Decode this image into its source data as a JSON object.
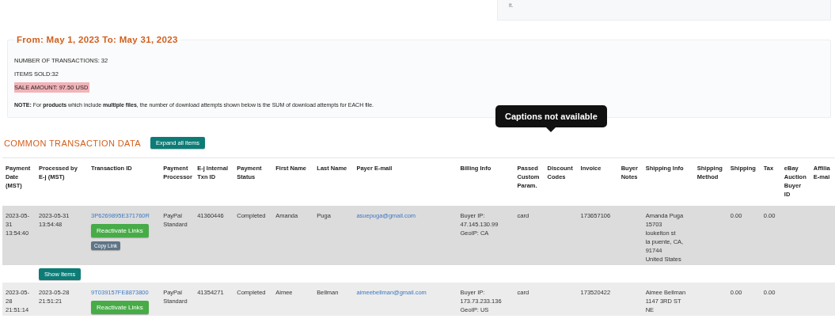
{
  "top_note": {
    "text": "it."
  },
  "summary": {
    "title": "From: May 1, 2023 To: May 31, 2023",
    "lines": [
      {
        "text": "NUMBER OF TRANSACTIONS: 32",
        "highlighted": false
      },
      {
        "text": "ITEMS SOLD:32",
        "highlighted": false
      },
      {
        "text": "SALE AMOUNT: 97.50 USD",
        "highlighted": true
      }
    ],
    "note": "**NOTE:** For **products** which include **multiple files**, the number of download attempts shown below is the SUM of download attempts for EACH file."
  },
  "tooltip": {
    "text": "Captions not available"
  },
  "section": {
    "title": "COMMON TRANSACTION DATA",
    "expand_button": "Expand all items"
  },
  "table": {
    "columns": [
      "Payment Date (MST)",
      "Processed by E-j (MST)",
      "Transaction ID",
      "Payment Processor",
      "E-j Internal Txn ID",
      "Payment Status",
      "First Name",
      "Last Name",
      "Payer E-mail",
      "Billing Info",
      "Passed Custom Param.",
      "Discount Codes",
      "Invoice",
      "Buyer Notes",
      "Shipping Info",
      "Shipping Method",
      "Shipping",
      "Tax",
      "eBay Auction Buyer ID",
      "Affilia E-mai"
    ],
    "rows": [
      {
        "payment_date": "2023-05-31 13:54:40",
        "processed": "2023-05-31 13:54:48",
        "transaction_id": "3P6269895E371760R",
        "buttons": [
          {
            "kind": "reactivate",
            "label": "Reactivate Links"
          },
          {
            "kind": "copy",
            "label": "Copy Link"
          }
        ],
        "processor": "PayPal Standard",
        "internal_id": "41360446",
        "status": "Completed",
        "first_name": "Amanda",
        "last_name": "Puga",
        "email": "asuepuga@gmail.com",
        "billing": [
          "Buyer IP:",
          "47.145.130.99",
          "GeoIP: CA"
        ],
        "custom_param": "card",
        "invoice": "173657106",
        "shipping_info": [
          "Amanda Puga",
          "15703",
          "loukelton st",
          "la puente, CA,",
          "91744",
          "United States"
        ],
        "shipping": "0.00",
        "tax": "0.00",
        "show_items": "Show Items"
      },
      {
        "payment_date": "2023-05-28 21:51:14",
        "processed": "2023-05-28 21:51:21",
        "transaction_id": "9T039157FE8873800",
        "buttons": [
          {
            "kind": "reactivate",
            "label": "Reactivate Links"
          }
        ],
        "processor": "PayPal Standard",
        "internal_id": "41354271",
        "status": "Completed",
        "first_name": "Aimee",
        "last_name": "Bellman",
        "email": "aimeebellman@gmail.com",
        "billing": [
          "Buyer IP:",
          "173.73.233.136",
          "GeoIP: US"
        ],
        "custom_param": "card",
        "invoice": "173520422",
        "shipping_info": [
          "Aimee Bellman",
          "1147 3RD ST",
          "NE"
        ],
        "shipping": "0.00",
        "tax": "0.00"
      }
    ]
  }
}
